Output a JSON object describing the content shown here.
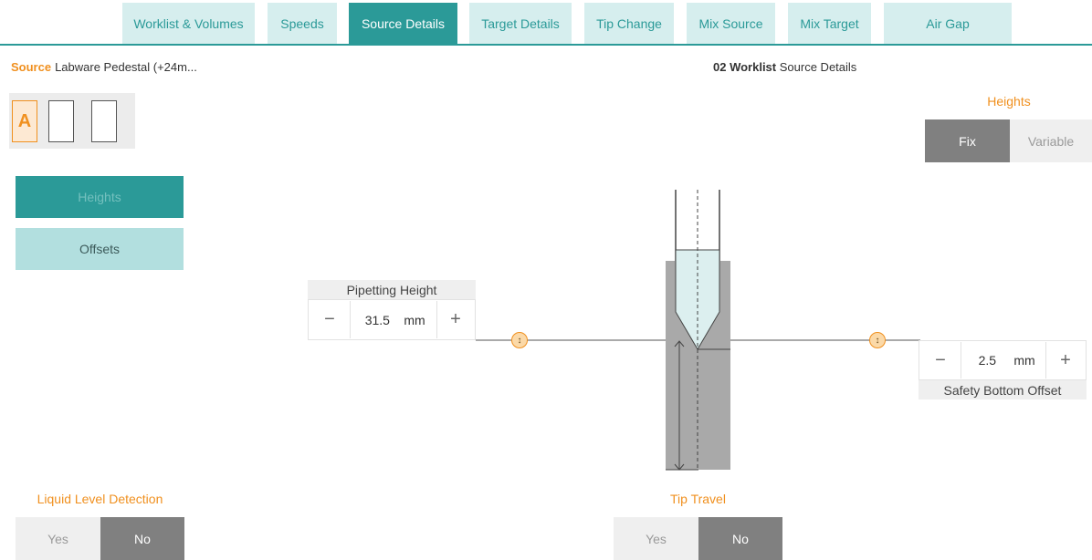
{
  "tabs": [
    {
      "label": "Worklist & Volumes",
      "active": false
    },
    {
      "label": "Speeds",
      "active": false
    },
    {
      "label": "Source Details",
      "active": true
    },
    {
      "label": "Target Details",
      "active": false
    },
    {
      "label": "Tip Change",
      "active": false
    },
    {
      "label": "Mix Source",
      "active": false
    },
    {
      "label": "Mix Target",
      "active": false
    },
    {
      "label": "Air Gap",
      "active": false
    }
  ],
  "source": {
    "label": "Source",
    "value": "Labware Pedestal (+24m..."
  },
  "page_title": {
    "bold": "02 Worklist",
    "rest": "Source Details"
  },
  "plate": {
    "selected_label": "A"
  },
  "side_menu": {
    "heights": "Heights",
    "offsets": "Offsets"
  },
  "heights_mode": {
    "title": "Heights",
    "fix": "Fix",
    "variable": "Variable",
    "selected": "Fix"
  },
  "pipetting_height": {
    "caption": "Pipetting Height",
    "value": "31.5",
    "unit": "mm",
    "minus": "−",
    "plus": "+"
  },
  "safety_bottom_offset": {
    "caption": "Safety Bottom Offset",
    "value": "2.5",
    "unit": "mm",
    "minus": "−",
    "plus": "+"
  },
  "liquid_level_detection": {
    "title": "Liquid Level Detection",
    "yes": "Yes",
    "no": "No",
    "selected": "No"
  },
  "tip_travel": {
    "title": "Tip Travel",
    "yes": "Yes",
    "no": "No",
    "selected": "No"
  },
  "icons": {
    "handle": "drag-updown-icon",
    "handle_glyph": "↕"
  },
  "colors": {
    "accent": "#2b9a98",
    "orange": "#f0901f",
    "tab_bg": "#d6eeee"
  }
}
